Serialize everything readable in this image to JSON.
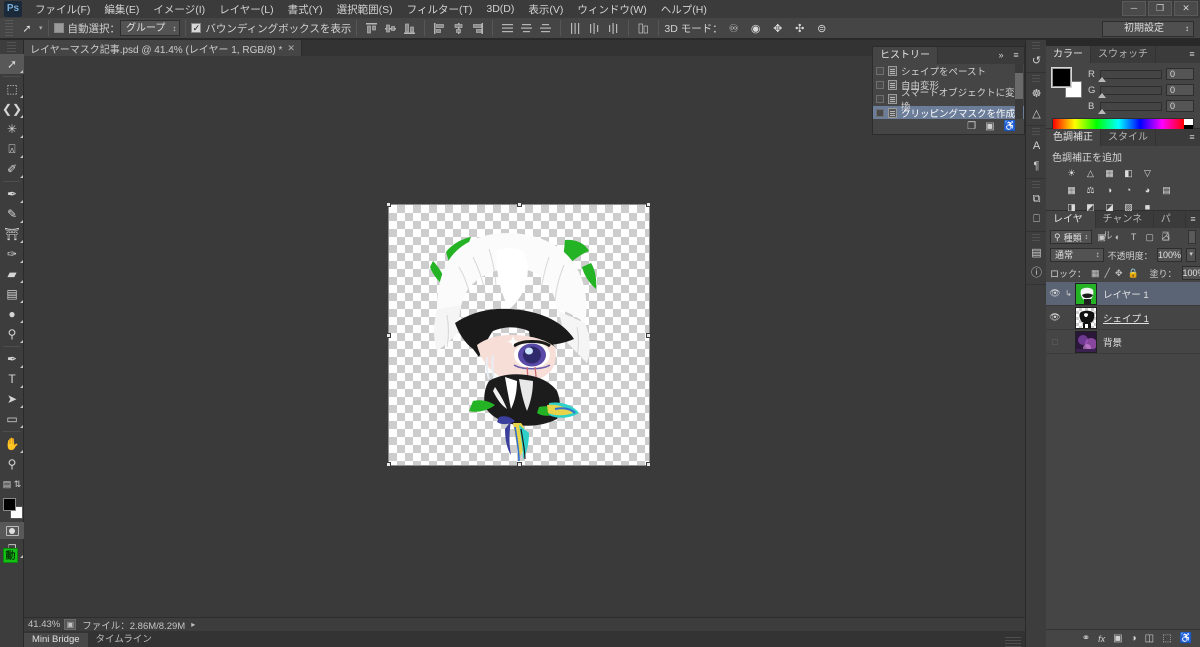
{
  "app": {
    "logo": "Ps",
    "window_controls": [
      "─",
      "❐",
      "✕"
    ]
  },
  "menubar": {
    "items": [
      "ファイル(F)",
      "編集(E)",
      "イメージ(I)",
      "レイヤー(L)",
      "書式(Y)",
      "選択範囲(S)",
      "フィルター(T)",
      "3D(D)",
      "表示(V)",
      "ウィンドウ(W)",
      "ヘルプ(H)"
    ]
  },
  "options_bar": {
    "tool_icon": "move-tool",
    "auto_select_label": "自動選択：",
    "auto_select_checked": false,
    "auto_select_scope": "グループ",
    "bounding_box_label": "バウンディングボックスを表示",
    "bounding_box_checked": true,
    "align_group_1": [
      "align-top-edges",
      "align-vertical-centers",
      "align-bottom-edges"
    ],
    "align_group_2": [
      "align-left-edges",
      "align-horizontal-centers",
      "align-right-edges"
    ],
    "distribute_group_1": [
      "distribute-top-edges",
      "distribute-vertical-centers",
      "distribute-bottom-edges"
    ],
    "distribute_group_2": [
      "distribute-left-edges",
      "distribute-horizontal-centers",
      "distribute-right-edges"
    ],
    "auto_align_icon": "auto-align-layers",
    "mode3d_label": "3D モード：",
    "mode3d_icons": [
      "rotate-3d-object",
      "roll-3d-object",
      "drag-3d-object",
      "slide-3d-object",
      "scale-3d-object"
    ],
    "workspace": "初期設定"
  },
  "toolbar": {
    "tools": [
      {
        "name": "move-tool",
        "glyph": "➚",
        "active": true,
        "has_submenu": true
      },
      {
        "name": "rectangular-marquee-tool",
        "glyph": "⬚",
        "active": false,
        "has_submenu": true
      },
      {
        "name": "lasso-tool",
        "glyph": "❦",
        "active": false,
        "has_submenu": true
      },
      {
        "name": "quick-selection-tool",
        "glyph": "✷",
        "active": false,
        "has_submenu": true
      },
      {
        "name": "crop-tool",
        "glyph": "⌗",
        "active": false,
        "has_submenu": true
      },
      {
        "name": "eyedropper-tool",
        "glyph": "✐",
        "active": false,
        "has_submenu": true
      },
      {
        "name": "spot-healing-brush-tool",
        "glyph": "✒",
        "active": false,
        "has_submenu": true
      },
      {
        "name": "brush-tool",
        "glyph": "✎",
        "active": false,
        "has_submenu": true
      },
      {
        "name": "clone-stamp-tool",
        "glyph": "⚓",
        "active": false,
        "has_submenu": true
      },
      {
        "name": "history-brush-tool",
        "glyph": "✑",
        "active": false,
        "has_submenu": true
      },
      {
        "name": "eraser-tool",
        "glyph": "▰",
        "active": false,
        "has_submenu": true
      },
      {
        "name": "gradient-tool",
        "glyph": "▤",
        "active": false,
        "has_submenu": true
      },
      {
        "name": "blur-tool",
        "glyph": "●",
        "active": false,
        "has_submenu": true
      },
      {
        "name": "dodge-tool",
        "glyph": "⚲",
        "active": false,
        "has_submenu": true
      },
      {
        "name": "pen-tool",
        "glyph": "✒",
        "active": false,
        "has_submenu": true
      },
      {
        "name": "horizontal-type-tool",
        "glyph": "T",
        "active": false,
        "has_submenu": true
      },
      {
        "name": "path-selection-tool",
        "glyph": "➤",
        "active": false,
        "has_submenu": true
      },
      {
        "name": "rectangle-tool",
        "glyph": "▭",
        "active": false,
        "has_submenu": true
      },
      {
        "name": "hand-tool",
        "glyph": "✋",
        "active": false,
        "has_submenu": true
      },
      {
        "name": "zoom-tool",
        "glyph": "⚲",
        "active": false,
        "has_submenu": false
      }
    ],
    "default_colors_icon": "default-foreground-background-colors",
    "swap_colors_icon": "swap-foreground-background-colors",
    "foreground_color": "#000000",
    "background_color": "#ffffff",
    "quick_mask_icon": "edit-in-quick-mask-mode",
    "screen_mode_icon": "change-screen-mode",
    "animation_badge": "動"
  },
  "document": {
    "tab_title": "レイヤーマスク記事.psd @ 41.4% (レイヤー 1, RGB/8) *",
    "close_glyph": "✕"
  },
  "status_bar": {
    "zoom": "41.43%",
    "preview_icon": "document-preview-icon",
    "info": "ファイル：2.86M/8.29M",
    "arrow": "▸"
  },
  "bottom_tabs": {
    "items": [
      {
        "label": "Mini Bridge",
        "active": true
      },
      {
        "label": "タイムライン",
        "active": false
      }
    ]
  },
  "icon_rail": {
    "groups": [
      [
        {
          "name": "history-panel-icon",
          "glyph": "↺"
        }
      ],
      [
        {
          "name": "color-wheel-panel-icon",
          "glyph": "☸"
        },
        {
          "name": "histogram-panel-icon",
          "glyph": "▲"
        }
      ],
      [
        {
          "name": "character-panel-icon",
          "glyph": "A"
        },
        {
          "name": "paragraph-panel-icon",
          "glyph": "¶"
        }
      ],
      [
        {
          "name": "layer-comps-panel-icon",
          "glyph": "⧉"
        },
        {
          "name": "character-styles-panel-icon",
          "glyph": "⎕"
        }
      ],
      [
        {
          "name": "actions-panel-icon",
          "glyph": "▤"
        },
        {
          "name": "info-panel-icon",
          "glyph": "ℹ"
        }
      ]
    ]
  },
  "history_panel": {
    "tabs": [
      {
        "label": "ヒストリー",
        "active": true
      }
    ],
    "collapse_glyph": "»",
    "menu_glyph": "≡",
    "items": [
      {
        "label": "シェイプをペースト",
        "selected": false
      },
      {
        "label": "自由変形",
        "selected": false
      },
      {
        "label": "スマートオブジェクトに変換",
        "selected": false
      },
      {
        "label": "クリッピングマスクを作成",
        "selected": true
      }
    ],
    "footer_icons": [
      {
        "name": "create-document-from-state-icon",
        "glyph": "❐"
      },
      {
        "name": "create-new-snapshot-icon",
        "glyph": "▣"
      },
      {
        "name": "delete-state-icon",
        "glyph": "⌧"
      }
    ]
  },
  "color_panel": {
    "tabs": [
      {
        "label": "カラー",
        "active": true
      },
      {
        "label": "スウォッチ",
        "active": false
      }
    ],
    "menu_glyph": "≡",
    "foreground_color": "#000000",
    "background_color": "#ffffff",
    "channels": [
      {
        "label": "R",
        "value": "0"
      },
      {
        "label": "G",
        "value": "0"
      },
      {
        "label": "B",
        "value": "0"
      }
    ]
  },
  "adjustments_panel": {
    "tabs": [
      {
        "label": "色調補正",
        "active": true
      },
      {
        "label": "スタイル",
        "active": false
      }
    ],
    "menu_glyph": "≡",
    "title": "色調補正を追加",
    "rows": [
      [
        {
          "name": "brightness-contrast-icon",
          "glyph": "☀"
        },
        {
          "name": "levels-icon",
          "glyph": "▲"
        },
        {
          "name": "curves-icon",
          "glyph": "⊞"
        },
        {
          "name": "exposure-icon",
          "glyph": "◧"
        },
        {
          "name": "vibrance-icon",
          "glyph": "▽"
        }
      ],
      [
        {
          "name": "hue-saturation-icon",
          "glyph": "▦"
        },
        {
          "name": "color-balance-icon",
          "glyph": "⚖"
        },
        {
          "name": "black-white-icon",
          "glyph": "◑"
        },
        {
          "name": "photo-filter-icon",
          "glyph": "◔"
        },
        {
          "name": "channel-mixer-icon",
          "glyph": "◕"
        },
        {
          "name": "color-lookup-icon",
          "glyph": "⊞"
        }
      ],
      [
        {
          "name": "invert-icon",
          "glyph": "◨"
        },
        {
          "name": "posterize-icon",
          "glyph": "◩"
        },
        {
          "name": "threshold-icon",
          "glyph": "◪"
        },
        {
          "name": "gradient-map-icon",
          "glyph": "▨"
        },
        {
          "name": "selective-color-icon",
          "glyph": "■"
        }
      ]
    ]
  },
  "layers_panel": {
    "tabs": [
      {
        "label": "レイヤー",
        "active": true
      },
      {
        "label": "チャンネル",
        "active": false
      },
      {
        "label": "パス",
        "active": false
      }
    ],
    "menu_glyph": "≡",
    "filter": {
      "kind_label": "種類",
      "search_icon": "filter-search-icon",
      "icons": [
        {
          "name": "filter-pixel-layers-icon",
          "glyph": "▣"
        },
        {
          "name": "filter-adjustment-layers-icon",
          "glyph": "◐"
        },
        {
          "name": "filter-type-layers-icon",
          "glyph": "T"
        },
        {
          "name": "filter-shape-layers-icon",
          "glyph": "▢"
        },
        {
          "name": "filter-smart-objects-icon",
          "glyph": "❑"
        }
      ],
      "toggle_name": "filter-enable-toggle"
    },
    "blend_mode": "通常",
    "opacity_label": "不透明度：",
    "opacity_value": "100%",
    "lock_label": "ロック：",
    "lock_icons": [
      {
        "name": "lock-transparent-pixels-icon",
        "glyph": "▦"
      },
      {
        "name": "lock-image-pixels-icon",
        "glyph": "╱"
      },
      {
        "name": "lock-position-icon",
        "glyph": "✥"
      },
      {
        "name": "lock-all-icon",
        "glyph": "⚿"
      }
    ],
    "fill_label": "塗り：",
    "fill_value": "100%",
    "layers": [
      {
        "name": "レイヤー 1",
        "visible": true,
        "selected": true,
        "clipped": true,
        "underlined": false,
        "thumb": "character-green"
      },
      {
        "name": "シェイプ 1",
        "visible": true,
        "selected": false,
        "clipped": false,
        "underlined": true,
        "thumb": "shape-black-white"
      },
      {
        "name": "背景",
        "visible": false,
        "selected": false,
        "clipped": false,
        "underlined": false,
        "thumb": "purple-photo"
      }
    ],
    "footer_icons": [
      {
        "name": "link-layers-icon",
        "glyph": "⚭"
      },
      {
        "name": "layer-style-icon",
        "glyph": "fx"
      },
      {
        "name": "add-layer-mask-icon",
        "glyph": "▣"
      },
      {
        "name": "new-fill-adjustment-layer-icon",
        "glyph": "◑"
      },
      {
        "name": "new-group-icon",
        "glyph": "☐"
      },
      {
        "name": "new-layer-icon",
        "glyph": "⬚"
      },
      {
        "name": "delete-layer-icon",
        "glyph": "⌧"
      }
    ]
  },
  "canvas": {
    "artboard_name": "transform-bounding-box",
    "handles": 8,
    "transparency_checker": true
  }
}
